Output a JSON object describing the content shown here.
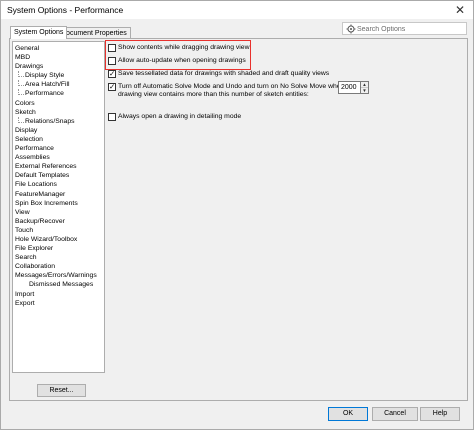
{
  "window": {
    "title": "System Options - Performance",
    "close_glyph": "✕"
  },
  "tabs": [
    {
      "label": "System Options",
      "active": true
    },
    {
      "label": "Document Properties",
      "active": false
    }
  ],
  "search": {
    "placeholder": "Search Options"
  },
  "tree": [
    {
      "label": "General",
      "level": 0
    },
    {
      "label": "MBD",
      "level": 0
    },
    {
      "label": "Drawings",
      "level": 0
    },
    {
      "label": "Display Style",
      "level": 1
    },
    {
      "label": "Area Hatch/Fill",
      "level": 1
    },
    {
      "label": "Performance",
      "level": 1
    },
    {
      "label": "Colors",
      "level": 0
    },
    {
      "label": "Sketch",
      "level": 0
    },
    {
      "label": "Relations/Snaps",
      "level": 1
    },
    {
      "label": "Display",
      "level": 0
    },
    {
      "label": "Selection",
      "level": 0
    },
    {
      "label": "Performance",
      "level": 0
    },
    {
      "label": "Assemblies",
      "level": 0
    },
    {
      "label": "External References",
      "level": 0
    },
    {
      "label": "Default Templates",
      "level": 0
    },
    {
      "label": "File Locations",
      "level": 0
    },
    {
      "label": "FeatureManager",
      "level": 0
    },
    {
      "label": "Spin Box Increments",
      "level": 0
    },
    {
      "label": "View",
      "level": 0
    },
    {
      "label": "Backup/Recover",
      "level": 0
    },
    {
      "label": "Touch",
      "level": 0
    },
    {
      "label": "Hole Wizard/Toolbox",
      "level": 0
    },
    {
      "label": "File Explorer",
      "level": 0
    },
    {
      "label": "Search",
      "level": 0
    },
    {
      "label": "Collaboration",
      "level": 0
    },
    {
      "label": "Messages/Errors/Warnings",
      "level": 0
    },
    {
      "label": "Dismissed Messages",
      "level": 2
    },
    {
      "label": "Import",
      "level": 0
    },
    {
      "label": "Export",
      "level": 0
    }
  ],
  "reset_label": "Reset...",
  "options": {
    "show_contents": {
      "label": "Show contents while dragging drawing view",
      "checked": false
    },
    "auto_update": {
      "label": "Allow auto-update when opening drawings",
      "checked": false
    },
    "save_tessellated": {
      "label": "Save tessellated data for drawings with shaded and draft quality views",
      "checked": true
    },
    "solve_mode": {
      "label_line1": "Turn off Automatic Solve Mode and Undo and turn on No Solve Move when",
      "label_line2": "drawing view contains more than this number of sketch entities:",
      "checked": true,
      "value": "2000"
    },
    "detailing_mode": {
      "label": "Always open a drawing in detailing mode",
      "checked": false
    }
  },
  "buttons": {
    "ok": "OK",
    "cancel": "Cancel",
    "help": "Help"
  },
  "colors": {
    "highlight": "#e8312d",
    "default_button_border": "#0078d7"
  }
}
